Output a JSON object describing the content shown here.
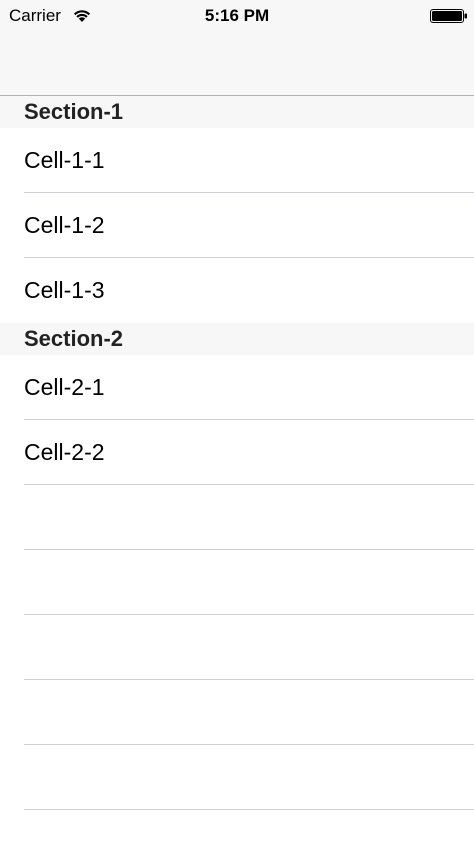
{
  "status_bar": {
    "carrier": "Carrier",
    "time": "5:16 PM",
    "wifi_icon": "wifi-icon",
    "battery_icon": "battery-icon"
  },
  "table": {
    "sections": [
      {
        "title": "Section-1",
        "cells": [
          "Cell-1-1",
          "Cell-1-2",
          "Cell-1-3"
        ]
      },
      {
        "title": "Section-2",
        "cells": [
          "Cell-2-1",
          "Cell-2-2"
        ]
      }
    ]
  },
  "colors": {
    "bar_background": "#f7f7f7",
    "section_header_background": "#f7f7f7",
    "separator": "#d0d0d4"
  }
}
